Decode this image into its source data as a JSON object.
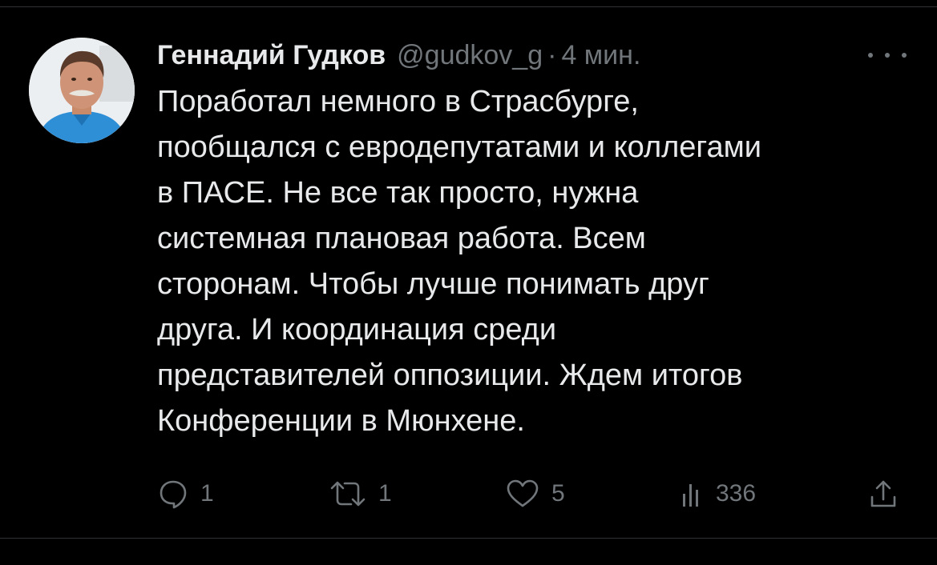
{
  "tweet": {
    "author": {
      "display_name": "Геннадий Гудков",
      "handle": "@gudkov_g",
      "separator": "·",
      "time_ago": "4 мин.",
      "avatar_icon": "profile-photo"
    },
    "text_lines": [
      "Поработал немного в Страсбурге,",
      "пообщался с евродепутатами и коллегами",
      "в ПАСЕ. Не все так просто, нужна",
      "системная плановая работа. Всем",
      "сторонам. Чтобы лучше понимать друг",
      "друга. И координация среди",
      "представителей оппозиции. Ждем итогов",
      "Конференции в Мюнхене."
    ],
    "actions": {
      "reply": {
        "icon": "reply-icon",
        "count": "1"
      },
      "retweet": {
        "icon": "retweet-icon",
        "count": "1"
      },
      "like": {
        "icon": "heart-icon",
        "count": "5"
      },
      "views": {
        "icon": "views-icon",
        "count": "336"
      },
      "share": {
        "icon": "share-icon"
      }
    },
    "more_icon": "more-icon"
  },
  "colors": {
    "background": "#000000",
    "text": "#e7e9ea",
    "secondary": "#71767b",
    "divider": "#2f3336"
  }
}
